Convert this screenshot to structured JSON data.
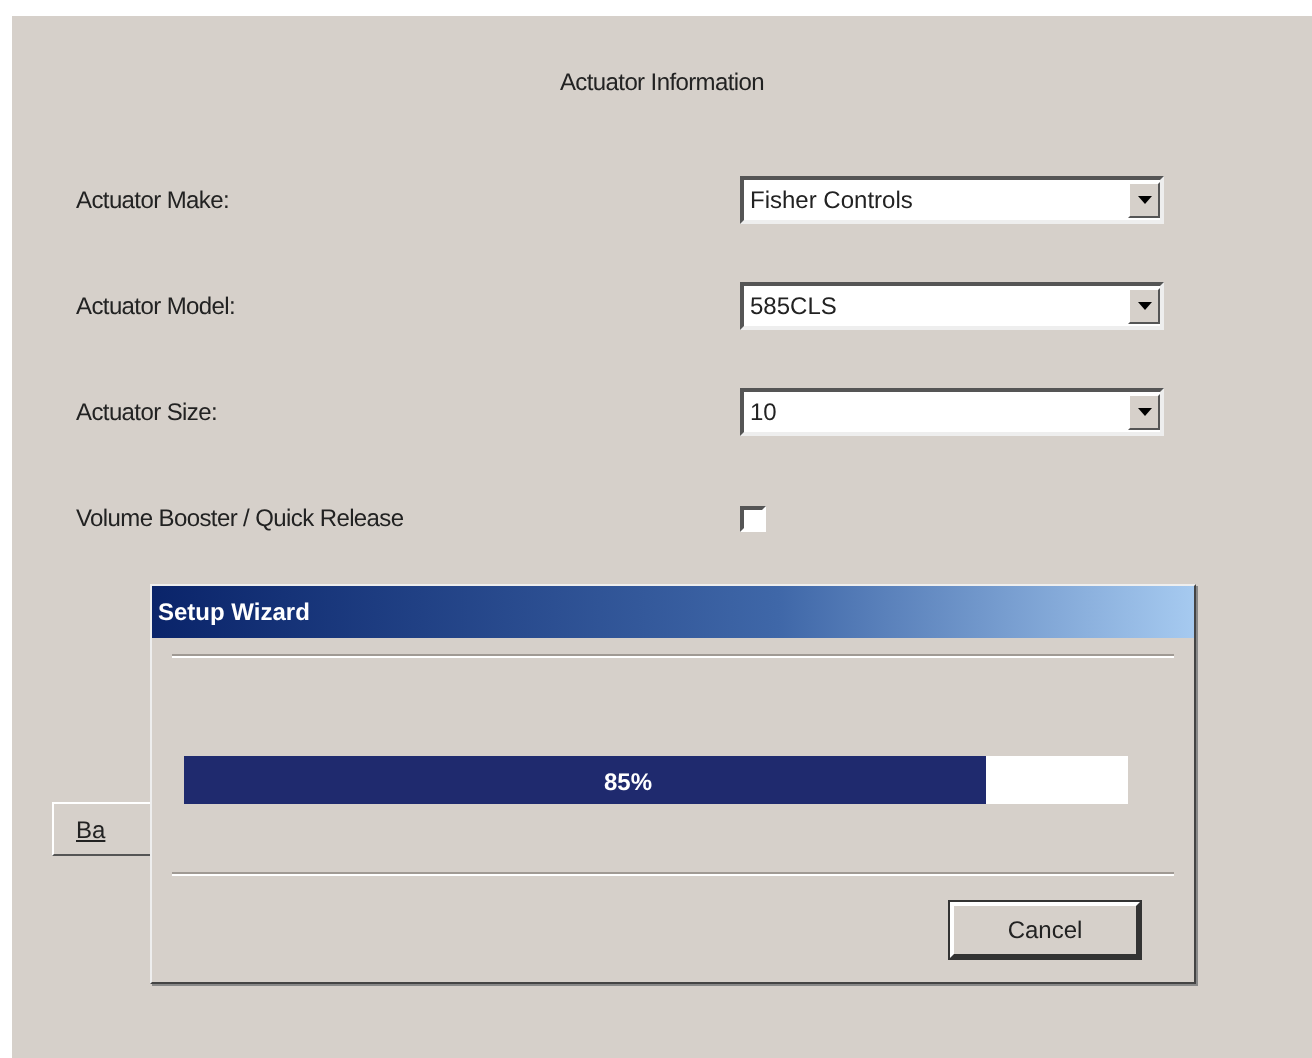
{
  "panel": {
    "title": "Actuator Information",
    "fields": [
      {
        "kind": "dropdown",
        "label": "Actuator Make:",
        "value": "Fisher Controls"
      },
      {
        "kind": "dropdown",
        "label": "Actuator Model:",
        "value": "585CLS"
      },
      {
        "kind": "dropdown",
        "label": "Actuator Size:",
        "value": "10"
      },
      {
        "kind": "checkbox",
        "label": "Volume Booster / Quick Release",
        "checked": false
      }
    ],
    "back_button": "Ba"
  },
  "dialog": {
    "title": "Setup Wizard",
    "progress": {
      "level": 0.85,
      "reading": "85%"
    },
    "cancel_button": "Cancel"
  }
}
